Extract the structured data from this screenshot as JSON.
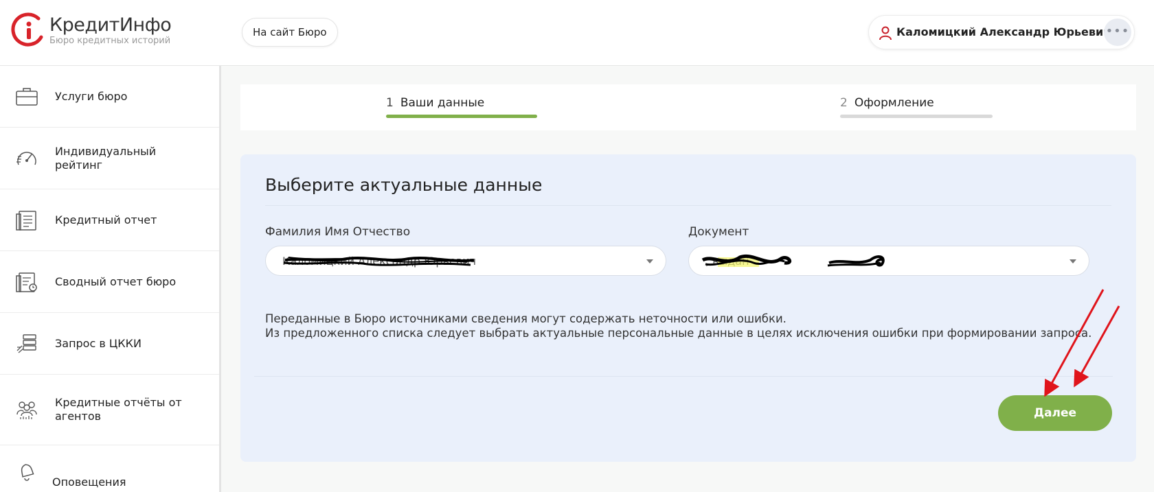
{
  "header": {
    "logo_name": "КредитИнфо",
    "logo_subtitle": "Бюро кредитных историй",
    "site_button": "На сайт Бюро",
    "user_name": "Каломицкий Александр Юрьевич",
    "more_label": "•••"
  },
  "sidebar": {
    "items": [
      {
        "label": "Услуги бюро",
        "icon": "briefcase-icon"
      },
      {
        "label": "Индивидуальный рейтинг",
        "icon": "speedometer-icon"
      },
      {
        "label": "Кредитный отчет",
        "icon": "document-icon"
      },
      {
        "label": "Сводный отчет бюро",
        "icon": "summary-report-icon"
      },
      {
        "label": "Запрос в ЦККИ",
        "icon": "server-request-icon"
      },
      {
        "label": "Кредитные отчёты от агентов",
        "icon": "agents-icon"
      },
      {
        "label": "Оповещения",
        "icon": "bell-icon"
      }
    ]
  },
  "stepper": {
    "steps": [
      {
        "num": "1",
        "label": "Ваши данные",
        "active": true
      },
      {
        "num": "2",
        "label": "Оформление",
        "active": false
      }
    ]
  },
  "form": {
    "title": "Выберите актуальные данные",
    "fio_label": "Фамилия Имя Отчество",
    "fio_value": "Каломицкий Александр Юрьевич",
    "document_label": "Документ",
    "document_value": "                    , выдан",
    "info_line1": "Переданные в Бюро источниками сведения могут содержать неточности или ошибки.",
    "info_line2": "Из предложенного списка следует выбрать актуальные персональные данные в целях исключения ошибки при формировании запроса.",
    "next_button": "Далее"
  },
  "colors": {
    "accent_green": "#80b04a",
    "brand_red": "#d8232a",
    "card_bg": "#eaf0fb",
    "annotation_red": "#e0141b"
  }
}
